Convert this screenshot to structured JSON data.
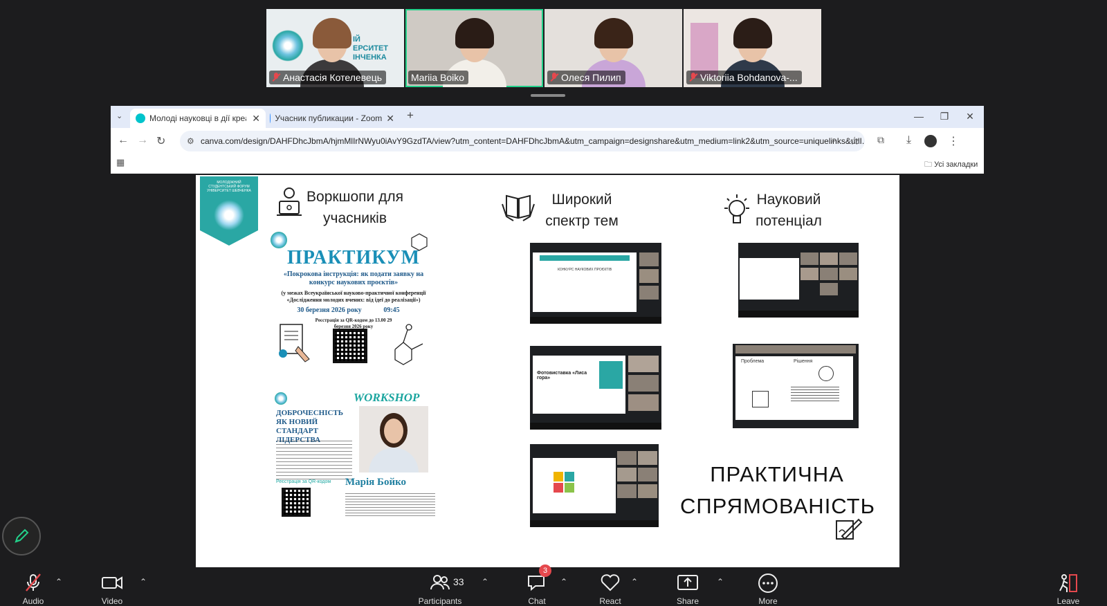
{
  "participants": [
    {
      "name": "Анастасія Котелевець",
      "muted": true,
      "bg_text": "ІЙ\nЕРСИТЕТ\nІНЧЕНКА"
    },
    {
      "name": "Mariia Boiko",
      "muted": false
    },
    {
      "name": "Олеся Пилип",
      "muted": true
    },
    {
      "name": "Viktoriia Bohdanova-...",
      "muted": true
    }
  ],
  "browser": {
    "tabs": [
      {
        "label": "Молоді науковці в дії креатив",
        "active": true
      },
      {
        "label": "Учасник публикации - Zoom",
        "active": false
      }
    ],
    "new_tab": "+",
    "url": "canva.com/design/DAHFDhcJbmA/hjmMlIrNWyu0iAvY9GzdTA/view?utm_content=DAHFDhcJbmA&utm_campaign=designshare&utm_medium=link2&utm_source=uniquelinks&utlI...",
    "bookmarks_label": "Усі закладки"
  },
  "slide": {
    "shield_text": "МОЛОДІЖНИЙ СТУДЕНТСЬКИЙ ФОРУМ УНІВЕРСИТЕТ ШЕВЧЕНКА",
    "headings": {
      "workshops": "Воркшопи для учасників",
      "topics": "Широкий спектр тем",
      "potential": "Науковий потенціал",
      "practical": "ПРАКТИЧНА СПРЯМОВАНІСТЬ"
    },
    "poster1": {
      "title": "ПРАКТИКУМ",
      "subtitle": "«Покрокова інструкція: як подати заявку на конкурс наукових проєктів»",
      "context": "(у межах Всеукраїнської науково-практичної конференції «Дослідження молодих вчених: від ідеї до реалізації»)",
      "date": "30 березня 2026 року",
      "time": "09:45",
      "registration": "Реєстрація за QR-кодом до 13.00 29 березня 2026 року"
    },
    "poster2": {
      "label": "WORKSHOP",
      "title": "ДОБРОЧЕСНІСТЬ ЯК НОВИЙ СТАНДАРТ ЛІДЕРСТВА",
      "speaker": "Марія Бойко",
      "registration": "Реєстрація за QR-кодом"
    },
    "thumbs": {
      "t1_title": "КОНКУРС НАУКОВИХ ПРОЄКТІВ",
      "t2_title": "Фотовиставка «Лиса гора»",
      "t5_left": "Проблема",
      "t5_right": "Рішення"
    }
  },
  "toolbar": {
    "audio": "Audio",
    "video": "Video",
    "participants": "Participants",
    "participants_count": "33",
    "chat": "Chat",
    "chat_badge": "3",
    "react": "React",
    "share": "Share",
    "more": "More",
    "leave": "Leave"
  },
  "colors": {
    "accent_green": "#23d18b",
    "muted_red": "#e5484d",
    "teal": "#2aa7a4",
    "chrome_tab": "#e3eaf8"
  }
}
